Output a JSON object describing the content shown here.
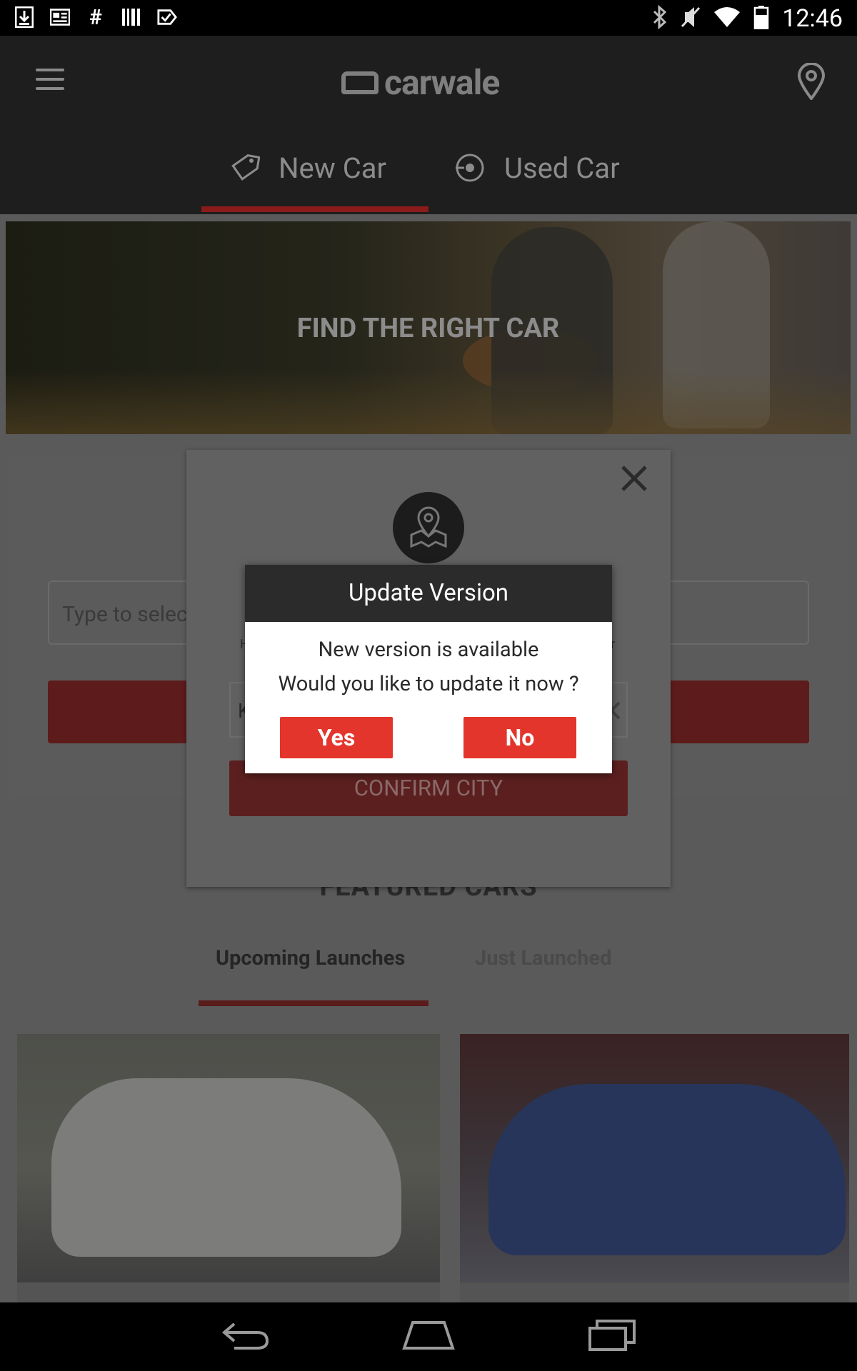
{
  "status_bar": {
    "time": "12:46",
    "left_icons": [
      "download-icon",
      "news-icon",
      "hashtag-icon",
      "barcode-icon",
      "check-icon"
    ],
    "right_icons": [
      "bluetooth-icon",
      "mute-icon",
      "wifi-icon",
      "battery-icon"
    ]
  },
  "app_bar": {
    "logo": "carwale",
    "tabs": [
      {
        "label": "New Car",
        "icon": "tag-key-icon",
        "selected": true
      },
      {
        "label": "Used Car",
        "icon": "used-car-icon",
        "selected": false
      }
    ]
  },
  "hero": {
    "title": "FIND THE RIGHT CAR"
  },
  "search": {
    "placeholder": "Type to select"
  },
  "featured": {
    "title": "FEATURED CARS",
    "tabs": [
      {
        "label": "Upcoming Launches",
        "selected": true
      },
      {
        "label": "Just Launched",
        "selected": false
      }
    ],
    "cards": [
      {
        "image": "white-sedan-car"
      },
      {
        "image": "blue-concept-suv"
      }
    ]
  },
  "city_modal": {
    "hint_left": "H",
    "hint_right": "r",
    "input_value": "K",
    "confirm_label": "CONFIRM CITY"
  },
  "update_dialog": {
    "title": "Update Version",
    "line1": "New version is available",
    "line2": "Would you like to update it now ?",
    "yes_label": "Yes",
    "no_label": "No"
  },
  "colors": {
    "accent": "#e3352b",
    "dialog_header": "#2b2b2b",
    "app_bar": "#1e1e1e"
  }
}
